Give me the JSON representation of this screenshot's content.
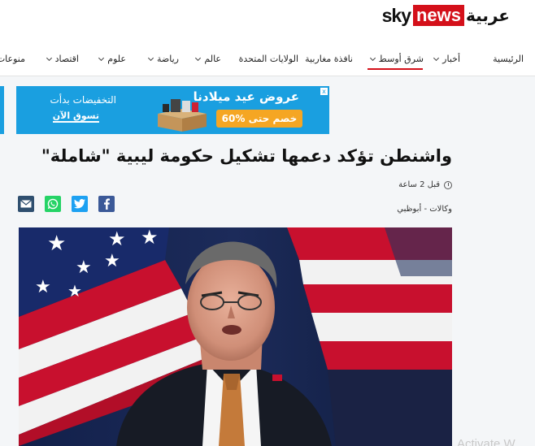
{
  "brand": {
    "sky": "sky",
    "news": "news",
    "arabic": "عربية",
    "accent_color": "#d4101a"
  },
  "nav": {
    "items": [
      {
        "label": "الرئيسية",
        "dropdown": false
      },
      {
        "label": "أخبار",
        "dropdown": true
      },
      {
        "label": "شرق أوسط",
        "dropdown": true,
        "active": true
      },
      {
        "label": "نافذة مغاربية",
        "dropdown": false
      },
      {
        "label": "الولايات المتحدة",
        "dropdown": false
      },
      {
        "label": "عالم",
        "dropdown": true
      },
      {
        "label": "رياضة",
        "dropdown": true
      },
      {
        "label": "علوم",
        "dropdown": true
      },
      {
        "label": "اقتصاد",
        "dropdown": true
      },
      {
        "label": "منوعات",
        "dropdown": false
      }
    ]
  },
  "ad": {
    "discounts": "التخفيضات بدأت",
    "shop_now": "تسوق الآن",
    "offers": "عروض عيد ميلادنا",
    "deal": "خصم حتى %60",
    "close": "x",
    "color": "#1a9fe0"
  },
  "article": {
    "headline": "واشنطن تؤكد دعمها تشكيل حكومة ليبية \"شاملة\"",
    "time": "قبل 2 ساعة",
    "source": "وكالات - أبوظبي"
  },
  "share": {
    "facebook_icon": "facebook-icon",
    "twitter_icon": "twitter-icon",
    "whatsapp_icon": "whatsapp-icon",
    "email_icon": "email-icon"
  },
  "watermark": "Activate W"
}
